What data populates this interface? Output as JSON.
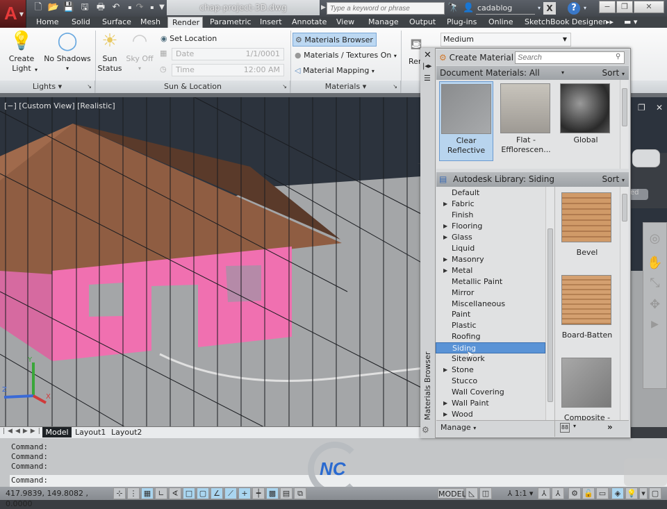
{
  "title_bar": {
    "app_button": "A",
    "file_name": "chap-project-3D.dwg",
    "search_placeholder": "Type a keyword or phrase",
    "user_name": "cadablog",
    "quick_access": [
      "new-icon",
      "open-icon",
      "save-icon",
      "save-as-icon",
      "plot-icon",
      "undo-icon",
      "redo-icon",
      "customize-dropdown-icon"
    ],
    "window_controls": {
      "minimize": "−",
      "restore": "❐",
      "close": "✕"
    }
  },
  "ribbon": {
    "tabs": [
      "Home",
      "Solid",
      "Surface",
      "Mesh",
      "Render",
      "Parametric",
      "Insert",
      "Annotate",
      "View",
      "Manage",
      "Output",
      "Plug-ins",
      "Online",
      "SketchBook Designer"
    ],
    "active_tab": "Render",
    "lights": {
      "create_light": "Create\nLight",
      "create_light_l1": "Create",
      "create_light_l2": "Light",
      "no_shadows": "No Shadows",
      "panel_title": "Lights ▾"
    },
    "sun_location": {
      "sun_status_l1": "Sun",
      "sun_status_l2": "Status",
      "sky_off": "Sky Off",
      "set_location": "Set Location",
      "date_label": "Date",
      "date_value": "1/1/0001",
      "time_label": "Time",
      "time_value": "12:00 AM",
      "panel_title": "Sun & Location"
    },
    "materials": {
      "browser": "Materials Browser",
      "textures": "Materials / Textures On",
      "mapping": "Material Mapping",
      "panel_title": "Materials ▾"
    },
    "render": {
      "quality": "Medium",
      "render_label": "Ren"
    }
  },
  "viewport": {
    "label": "[−] [Custom View] [Realistic]",
    "ucs": {
      "x": "X",
      "y": "Y",
      "z": "Z"
    },
    "nav_partial": "ed"
  },
  "layout_tabs": [
    "Model",
    "Layout1",
    "Layout2"
  ],
  "active_layout": "Model",
  "command": {
    "history": [
      "Command:",
      "Command:",
      "Command:"
    ],
    "prompt": "Command:"
  },
  "status_bar": {
    "coords": "417.9839, 149.8082 , 0.0000",
    "model": "MODEL",
    "scale": "1:1"
  },
  "materials_browser": {
    "title": "Materials Browser",
    "create_material": "Create Material",
    "search_placeholder": "Search",
    "doc_filter": "Document Materials: All",
    "sort": "Sort",
    "document_materials": [
      {
        "name_l1": "Clear",
        "name_l2": "Reflective",
        "selected": true
      },
      {
        "name_l1": "Flat -",
        "name_l2": "Efflorescen...",
        "selected": false
      },
      {
        "name_l1": "Global",
        "name_l2": "",
        "selected": false
      }
    ],
    "library_title": "Autodesk Library: Siding",
    "categories": [
      {
        "name": "Default",
        "expandable": false
      },
      {
        "name": "Fabric",
        "expandable": true
      },
      {
        "name": "Finish",
        "expandable": false
      },
      {
        "name": "Flooring",
        "expandable": true
      },
      {
        "name": "Glass",
        "expandable": true
      },
      {
        "name": "Liquid",
        "expandable": false
      },
      {
        "name": "Masonry",
        "expandable": true
      },
      {
        "name": "Metal",
        "expandable": true
      },
      {
        "name": "Metallic Paint",
        "expandable": false
      },
      {
        "name": "Mirror",
        "expandable": false
      },
      {
        "name": "Miscellaneous",
        "expandable": false
      },
      {
        "name": "Paint",
        "expandable": false
      },
      {
        "name": "Plastic",
        "expandable": false
      },
      {
        "name": "Roofing",
        "expandable": false
      },
      {
        "name": "Siding",
        "expandable": false
      },
      {
        "name": "Sitework",
        "expandable": false
      },
      {
        "name": "Stone",
        "expandable": true
      },
      {
        "name": "Stucco",
        "expandable": false
      },
      {
        "name": "Wall Covering",
        "expandable": false
      },
      {
        "name": "Wall Paint",
        "expandable": true
      },
      {
        "name": "Wood",
        "expandable": true
      }
    ],
    "selected_category": "Siding",
    "library_materials": [
      "Bevel",
      "Board-Batten",
      "Composite -"
    ],
    "manage": "Manage",
    "view_toggle": "88",
    "more": "»"
  },
  "colors": {
    "accent_blue": "#5a93d6",
    "wall_pink": "#f070b0",
    "roof_brown": "#8a5a40",
    "ground_gray": "#a4a6a8",
    "sky_dark": "#2c333d"
  }
}
